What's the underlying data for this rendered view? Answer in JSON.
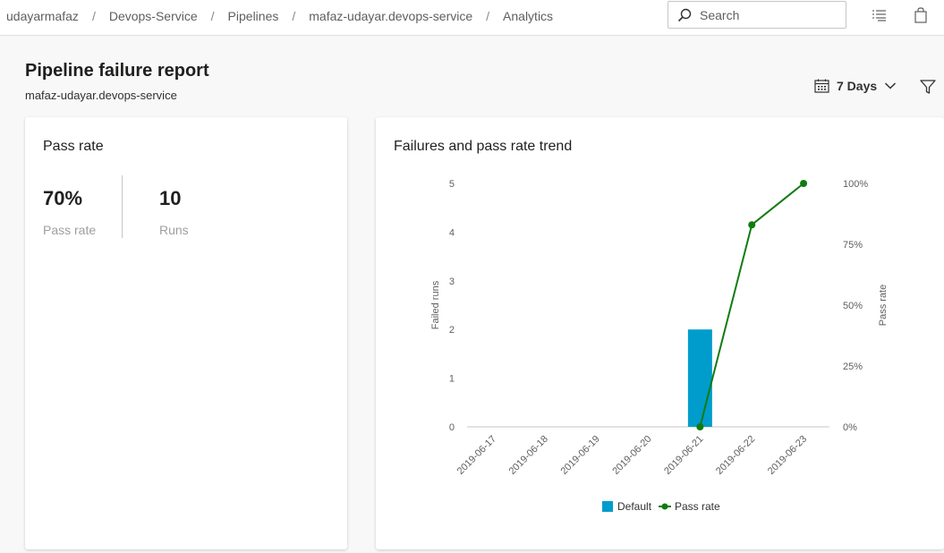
{
  "breadcrumb": [
    "udayarmafaz",
    "Devops-Service",
    "Pipelines",
    "mafaz-udayar.devops-service",
    "Analytics"
  ],
  "search": {
    "placeholder": "Search"
  },
  "icons": {
    "search": "search-icon",
    "list": "list-settings-icon",
    "bag": "shopping-bag-icon",
    "calendar": "calendar-icon",
    "chevron": "chevron-down-icon",
    "filter": "filter-icon"
  },
  "header": {
    "title": "Pipeline failure report",
    "subtitle": "mafaz-udayar.devops-service"
  },
  "range": {
    "label": "7 Days"
  },
  "pass_card": {
    "title": "Pass rate",
    "pass_rate": {
      "value": "70%",
      "label": "Pass rate"
    },
    "runs": {
      "value": "10",
      "label": "Runs"
    }
  },
  "trend_card": {
    "title": "Failures and pass rate trend"
  },
  "colors": {
    "bar": "#009ccc",
    "line": "#107c10",
    "accent": "#0078d4"
  },
  "chart_data": {
    "type": "bar",
    "categories": [
      "2019-06-17",
      "2019-06-18",
      "2019-06-19",
      "2019-06-20",
      "2019-06-21",
      "2019-06-22",
      "2019-06-23"
    ],
    "series": [
      {
        "name": "Default",
        "type": "bar",
        "axis": "left",
        "values": [
          0,
          0,
          0,
          0,
          2,
          0,
          0
        ]
      },
      {
        "name": "Pass rate",
        "type": "line",
        "axis": "right",
        "x": [
          "2019-06-21",
          "2019-06-22",
          "2019-06-23"
        ],
        "values": [
          0,
          83,
          100
        ]
      }
    ],
    "ylabel": "Failed runs",
    "y2label": "Pass rate",
    "ylim": [
      0,
      5
    ],
    "y2lim": [
      0,
      100
    ],
    "yticks": [
      "0",
      "1",
      "2",
      "3",
      "4",
      "5"
    ],
    "y2ticks": [
      "0%",
      "25%",
      "50%",
      "75%",
      "100%"
    ],
    "legend": "bottom"
  }
}
